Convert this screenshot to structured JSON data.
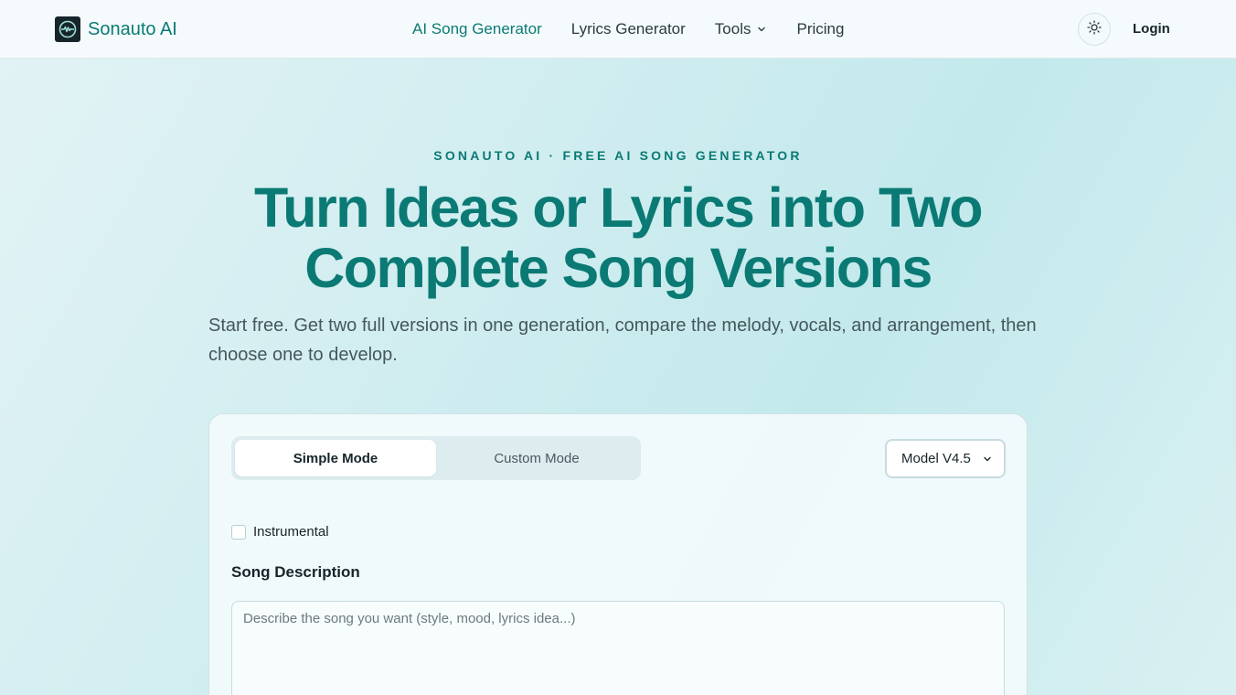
{
  "header": {
    "logo_text": "Sonauto AI",
    "logo_icon": "waveform-logo-icon",
    "nav": [
      {
        "label": "AI Song Generator",
        "active": true
      },
      {
        "label": "Lyrics Generator",
        "active": false
      },
      {
        "label": "Tools",
        "active": false,
        "has_dropdown": true
      },
      {
        "label": "Pricing",
        "active": false
      }
    ],
    "theme_icon": "sun-icon",
    "login_label": "Login"
  },
  "hero": {
    "eyebrow": "SONAUTO AI · FREE AI SONG GENERATOR",
    "title_line1": "Turn Ideas or Lyrics into Two",
    "title_line2": "Complete Song Versions",
    "subtitle": "Start free. Get two full versions in one generation, compare the melody, vocals, and arrangement, then choose one to develop."
  },
  "form": {
    "modes": [
      {
        "label": "Simple Mode",
        "active": true
      },
      {
        "label": "Custom Mode",
        "active": false
      }
    ],
    "model_select": "Model V4.5",
    "instrumental_label": "Instrumental",
    "instrumental_checked": false,
    "description_label": "Song Description",
    "description_placeholder": "Describe the song you want (style, mood, lyrics idea...)",
    "description_value": ""
  },
  "colors": {
    "accent": "#0b7a74",
    "dark": "#17252a",
    "background": "#cdecef"
  }
}
